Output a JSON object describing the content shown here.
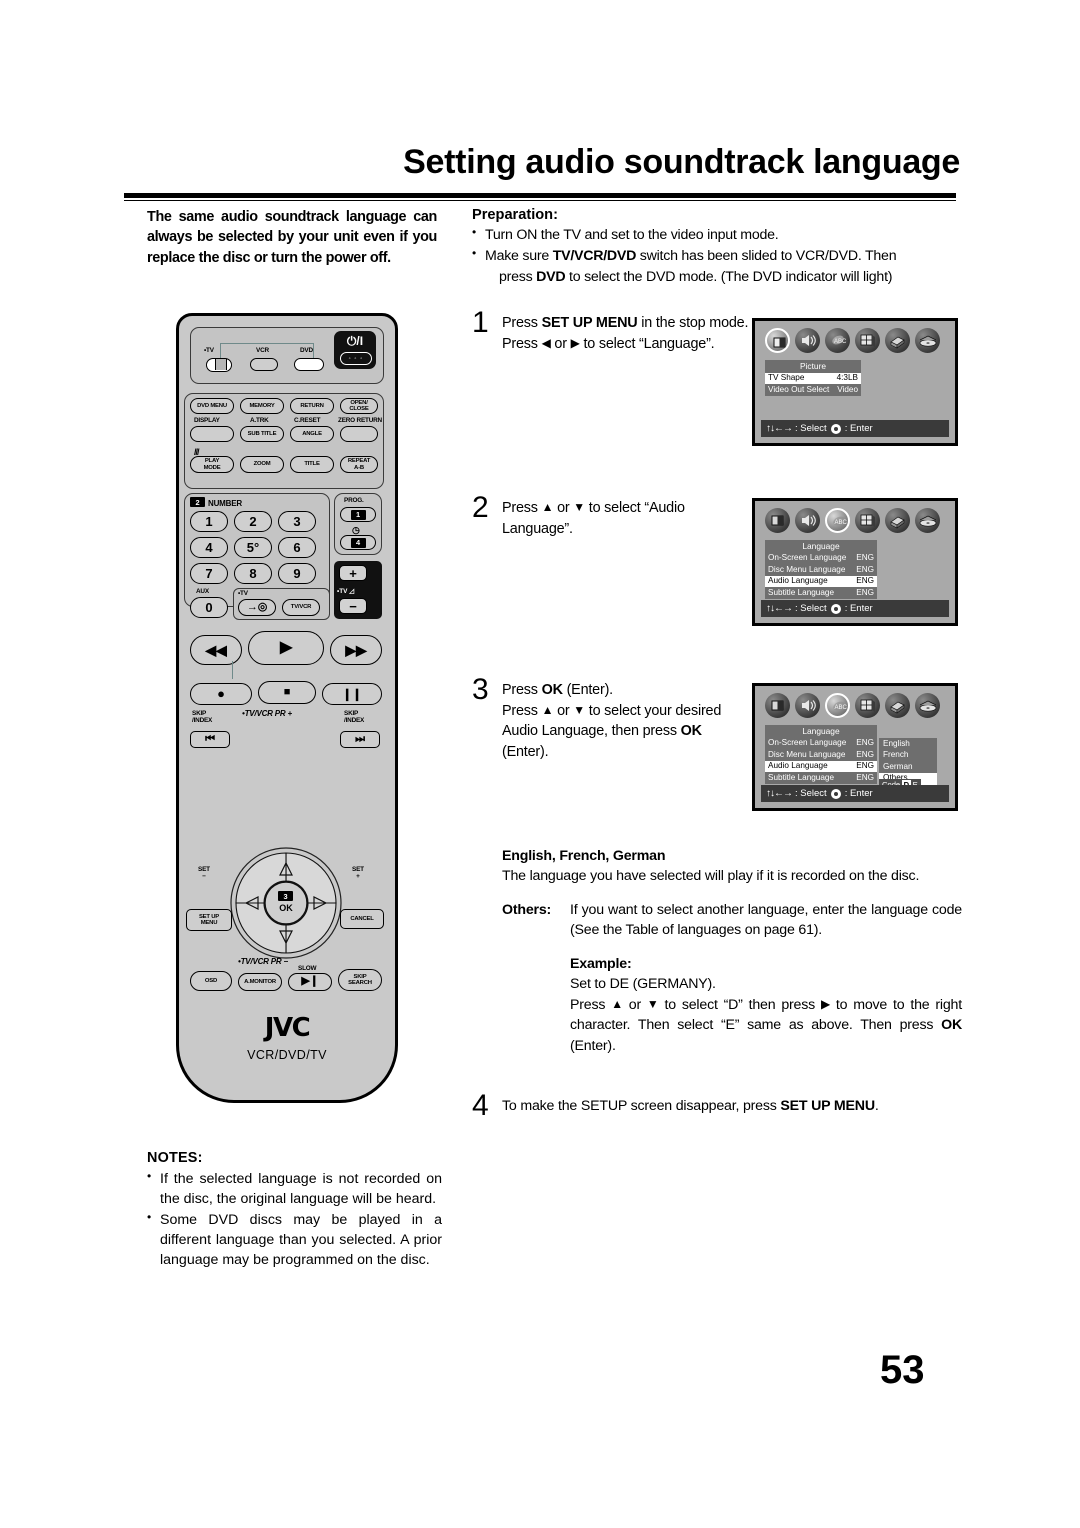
{
  "page": {
    "title": "Setting audio soundtrack language",
    "number": "53"
  },
  "intro": {
    "text": "The same audio soundtrack language can always be selected by your unit even if you replace the disc or turn the power off."
  },
  "preparation": {
    "title": "Preparation:",
    "bullet1": "Turn ON the TV and set to the video input mode.",
    "bullet2_a": "Make sure ",
    "bullet2_b": "TV/VCR/DVD",
    "bullet2_c": " switch has been slided to VCR/DVD. Then",
    "bullet2_d": "press ",
    "bullet2_e": "DVD",
    "bullet2_f": " to select the DVD mode. (The DVD indicator will light)"
  },
  "steps": {
    "one": {
      "num": "1",
      "line1_a": "Press ",
      "line1_b": "SET UP MENU",
      "line1_c": " in the stop mode.",
      "line2_a": "Press ",
      "line2_b": " or ",
      "line2_c": " to select “Language”."
    },
    "two": {
      "num": "2",
      "line_a": "Press ",
      "line_b": " or ",
      "line_c": " to select “Audio Language”."
    },
    "three": {
      "num": "3",
      "line1_a": "Press ",
      "line1_b": "OK",
      "line1_c": " (Enter).",
      "line2_a": "Press ",
      "line2_b": " or ",
      "line2_c": " to select your desired Audio Language, then press ",
      "line2_d": "OK",
      "line2_e": " (Enter)."
    },
    "four": {
      "num": "4",
      "line_a": "To make the SETUP screen disappear, press ",
      "line_b": "SET UP MENU",
      "line_c": "."
    }
  },
  "explain": {
    "heading": "English, French, German",
    "body": "The language you have selected will play if it is recorded on the disc.",
    "others_key": "Others:",
    "others_text": "If you want to select another language, enter the language code (See the Table of languages on page 61).",
    "example_heading": "Example:",
    "example_l1": "Set to DE (GERMANY).",
    "example_l2_a": "Press ",
    "example_l2_b": " or ",
    "example_l2_c": " to select “D” then press ",
    "example_l2_d": " to move to the right character. Then select “E” same as above. Then press ",
    "example_l2_e": "OK",
    "example_l2_f": " (Enter)."
  },
  "notes": {
    "title": "NOTES:",
    "items": [
      "If the selected language is not recorded on the disc, the original language will be heard.",
      "Some DVD discs may be played in a different language than you selected. A prior language may be programmed on the disc."
    ]
  },
  "osd": {
    "screen1": {
      "menu_title": "Picture",
      "rows": [
        {
          "label": "TV Shape",
          "value": "4:3LB",
          "highlight": true
        },
        {
          "label": "Video Out Select",
          "value": "Video",
          "highlight": false
        }
      ],
      "selected_icon": 0,
      "bar_arrows": "↑↓←→",
      "bar_select": ": Select",
      "bar_enter": ": Enter"
    },
    "screen2": {
      "menu_title": "Language",
      "rows": [
        {
          "label": "On-Screen Language",
          "value": "ENG",
          "highlight": false
        },
        {
          "label": "Disc Menu Language",
          "value": "ENG",
          "highlight": false
        },
        {
          "label": "Audio Language",
          "value": "ENG",
          "highlight": true
        },
        {
          "label": "Subtitle Language",
          "value": "ENG",
          "highlight": false
        }
      ],
      "selected_icon": 2,
      "bar_arrows": "↑↓←→",
      "bar_select": ": Select",
      "bar_enter": ": Enter"
    },
    "screen3": {
      "menu_title": "Language",
      "rows": [
        {
          "label": "On-Screen Language",
          "value": "ENG",
          "highlight": false
        },
        {
          "label": "Disc Menu Language",
          "value": "ENG",
          "highlight": false
        },
        {
          "label": "Audio Language",
          "value": "ENG",
          "highlight": true
        },
        {
          "label": "Subtitle Language",
          "value": "ENG",
          "highlight": false
        }
      ],
      "submenu": [
        {
          "label": "English",
          "highlight": false
        },
        {
          "label": "French",
          "highlight": false
        },
        {
          "label": "German",
          "highlight": false
        },
        {
          "label": "Others",
          "highlight": true
        }
      ],
      "code_label": "Code",
      "code_char1": "D",
      "code_char2": "E",
      "selected_icon": 2,
      "bar_arrows": "↑↓←→",
      "bar_select": ": Select",
      "bar_enter": ": Enter"
    },
    "icon_names": [
      "picture-icon",
      "audio-icon",
      "language-icon",
      "display-icon",
      "others-icon",
      "disc-icon"
    ]
  },
  "remote": {
    "brand": "JVC",
    "brand_sub": "VCR/DVD/TV",
    "mode_tv": "•TV",
    "mode_vcr": "VCR",
    "mode_dvd": "DVD",
    "power_symbol": "⏻/I",
    "power_dots": "◦ ◦ ◦",
    "row1": [
      "DVD MENU",
      "MEMORY",
      "RETURN",
      "OPEN/\nCLOSE"
    ],
    "row2_labels": [
      "DISPLAY",
      "A.TRK",
      "C.RESET",
      "ZERO RETURN"
    ],
    "row2": [
      "",
      "SUB TITLE",
      "ANGLE",
      ""
    ],
    "row3": [
      "PLAY\nMODE",
      "ZOOM",
      "TITLE",
      "REPEAT\nA-B"
    ],
    "number_label": "NUMBER",
    "number_badge": "2",
    "numbers": [
      "1",
      "2",
      "3",
      "4",
      "5°",
      "6",
      "7",
      "8",
      "9",
      "0"
    ],
    "aux_label": "AUX",
    "tv_label": "•TV",
    "tvvcr": "TV/VCR",
    "prog_label": "PROG.",
    "prog_badge1": "1",
    "prog_badge2": "4",
    "tvvol_label": "•TV",
    "tvvol_plus": "+",
    "tvvol_minus": "−",
    "skip_index_left": "SKIP\n/INDEX",
    "skip_index_right": "SKIP\n/INDEX",
    "tvvcr_pr_plus": "•TV/VCR PR +",
    "tvvcr_pr_minus": "•TV/VCR PR −",
    "set_minus": "SET\n−",
    "set_plus": "SET\n+",
    "ok_label": "OK",
    "ok_badge": "3",
    "setup_menu": "SET UP\nMENU",
    "cancel": "CANCEL",
    "osd": "OSD",
    "amonitor": "A.MONITOR",
    "slow": "SLOW",
    "skip_search": "SKIP\nSEARCH"
  }
}
